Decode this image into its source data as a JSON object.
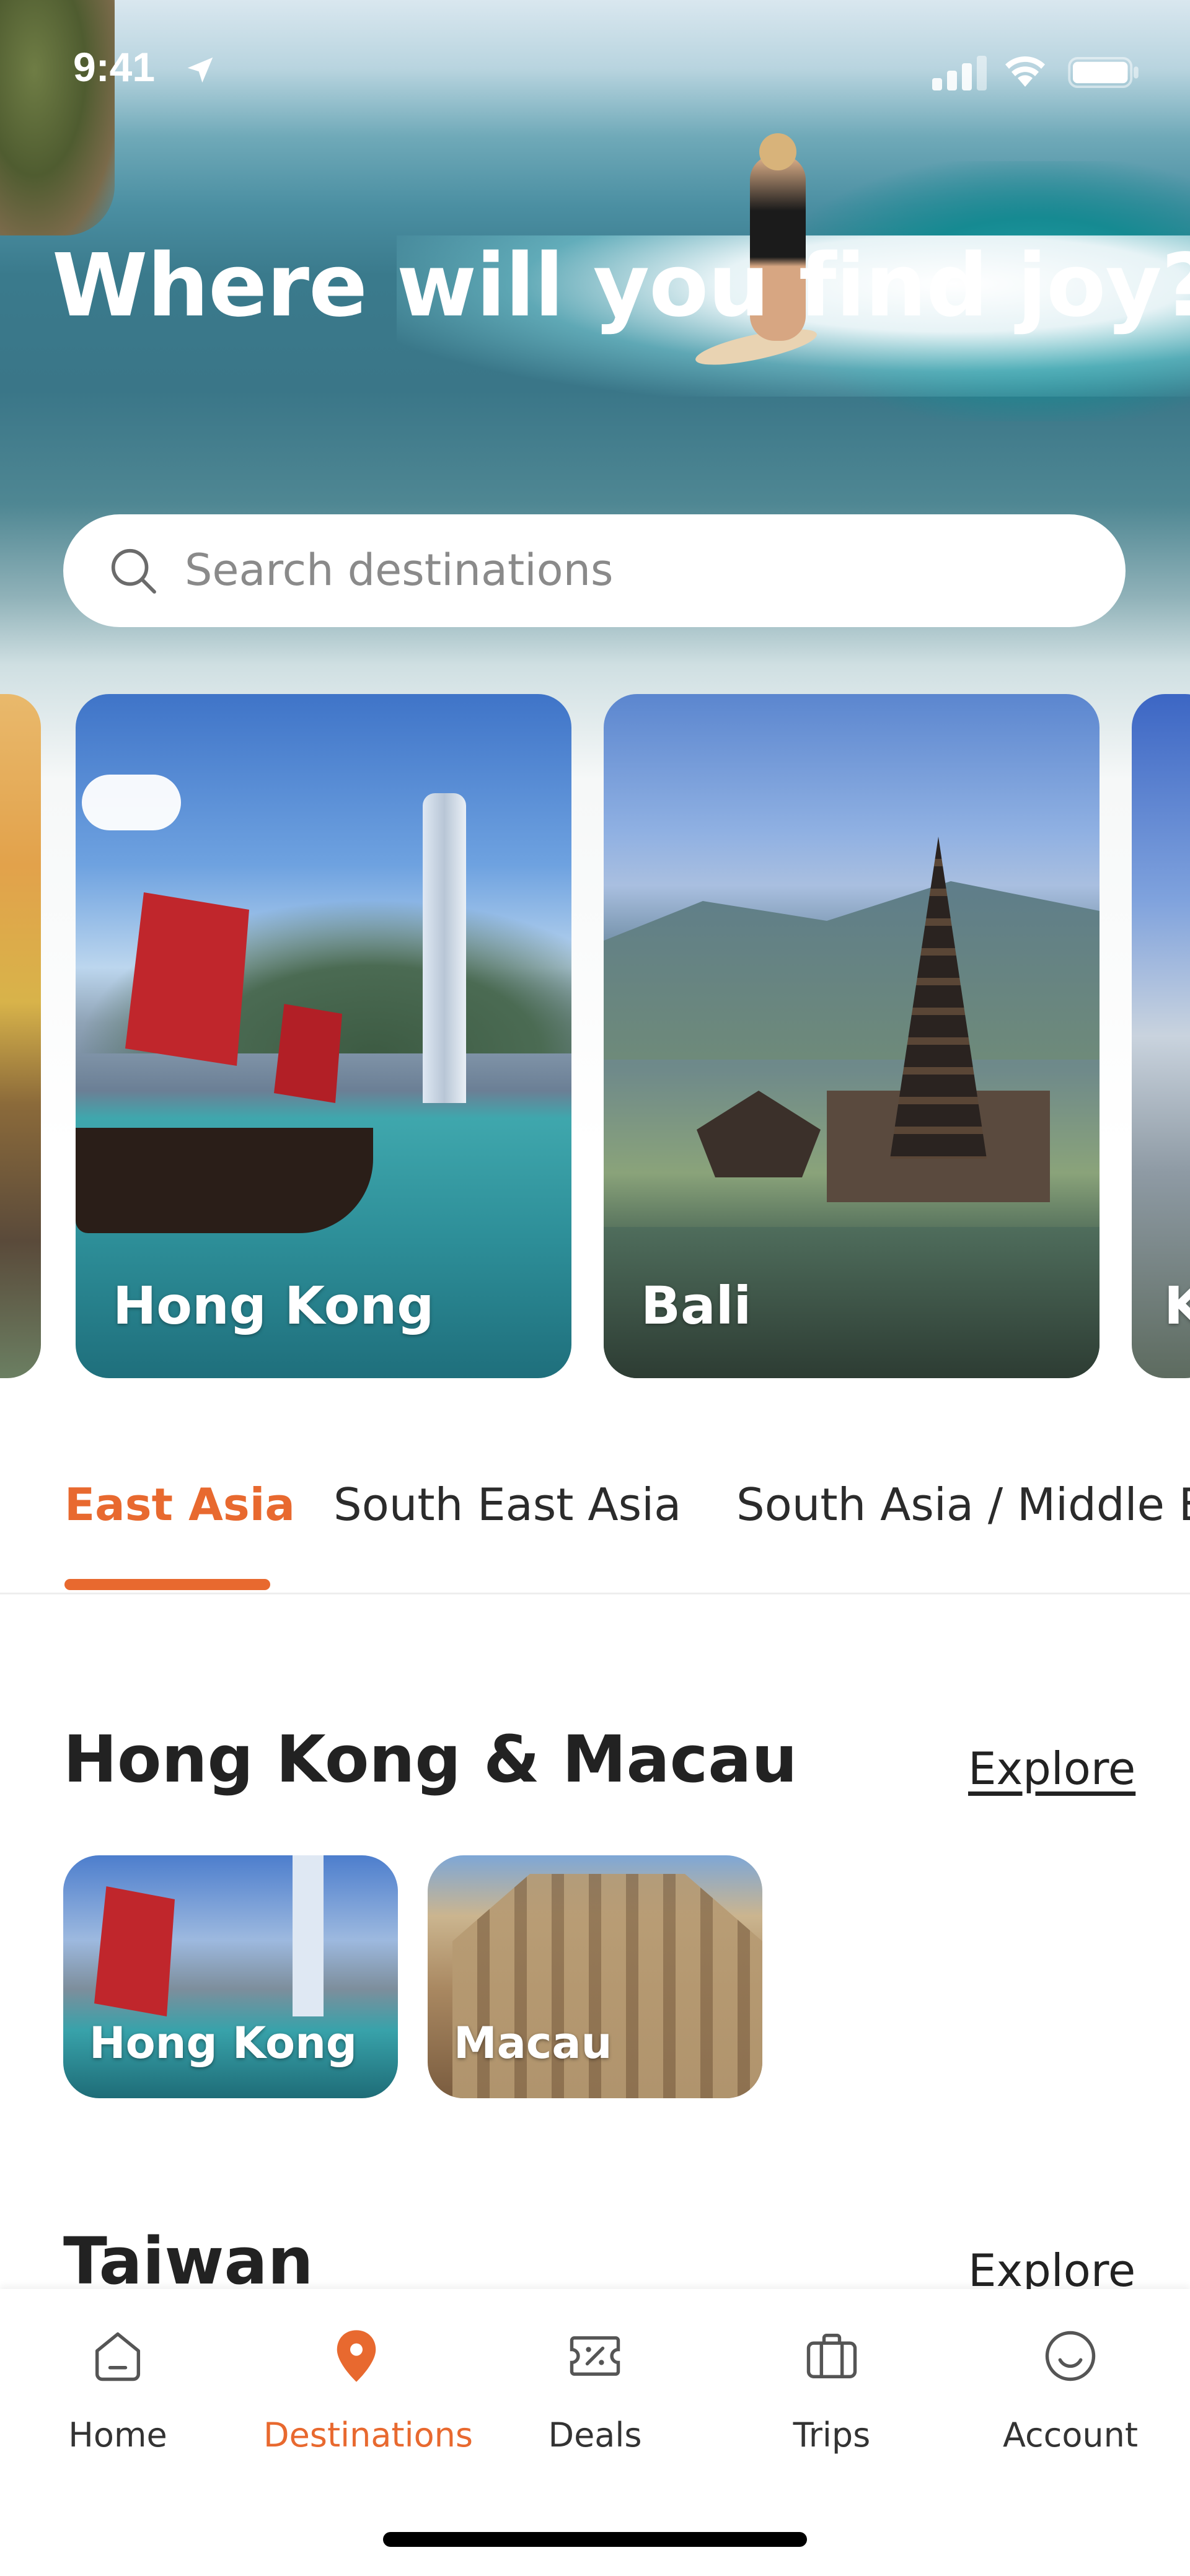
{
  "status_bar": {
    "time": "9:41"
  },
  "hero": {
    "title": "Where will you find joy?"
  },
  "search": {
    "placeholder": "Search destinations"
  },
  "carousel": {
    "cards": [
      {
        "label": "Hong Kong"
      },
      {
        "label": "Bali"
      },
      {
        "label": "K"
      }
    ]
  },
  "tabs": [
    {
      "label": "East Asia",
      "active": true
    },
    {
      "label": "South East Asia",
      "active": false
    },
    {
      "label": "South Asia / Middle E",
      "active": false
    }
  ],
  "sections": [
    {
      "title": "Hong Kong & Macau",
      "explore": "Explore",
      "items": [
        {
          "label": "Hong Kong"
        },
        {
          "label": "Macau"
        }
      ]
    },
    {
      "title": "Taiwan",
      "explore": "Explore"
    }
  ],
  "bottom_nav": {
    "items": [
      {
        "label": "Home",
        "icon": "home-icon",
        "active": false
      },
      {
        "label": "Destinations",
        "icon": "location-pin-icon",
        "active": true
      },
      {
        "label": "Deals",
        "icon": "ticket-percent-icon",
        "active": false
      },
      {
        "label": "Trips",
        "icon": "suitcase-icon",
        "active": false
      },
      {
        "label": "Account",
        "icon": "smiley-face-icon",
        "active": false
      }
    ]
  },
  "colors": {
    "accent": "#e8692f",
    "text": "#222222",
    "muted": "#8a8a8a"
  }
}
